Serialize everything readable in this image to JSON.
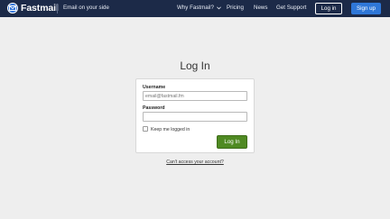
{
  "header": {
    "logo_text": "Fastmail",
    "tagline": "Email on your side",
    "nav": {
      "why": "Why Fastmail?",
      "pricing": "Pricing",
      "news": "News",
      "support": "Get Support"
    },
    "login_label": "Log in",
    "signup_label": "Sign up"
  },
  "main": {
    "title": "Log In",
    "username_label": "Username",
    "username_placeholder": "email@fastmail.fm",
    "username_value": "",
    "password_label": "Password",
    "password_value": "",
    "remember_label": "Keep me logged in",
    "remember_checked": false,
    "submit_label": "Log In",
    "forgot_link": "Can't access your account?"
  },
  "colors": {
    "header_bg": "#1c2a48",
    "signup_bg": "#2f77d8",
    "login_button_bg": "#4f8a22",
    "page_bg": "#eeeeee"
  },
  "icons": [
    "fastmail-logo-icon",
    "chevron-down-icon"
  ]
}
